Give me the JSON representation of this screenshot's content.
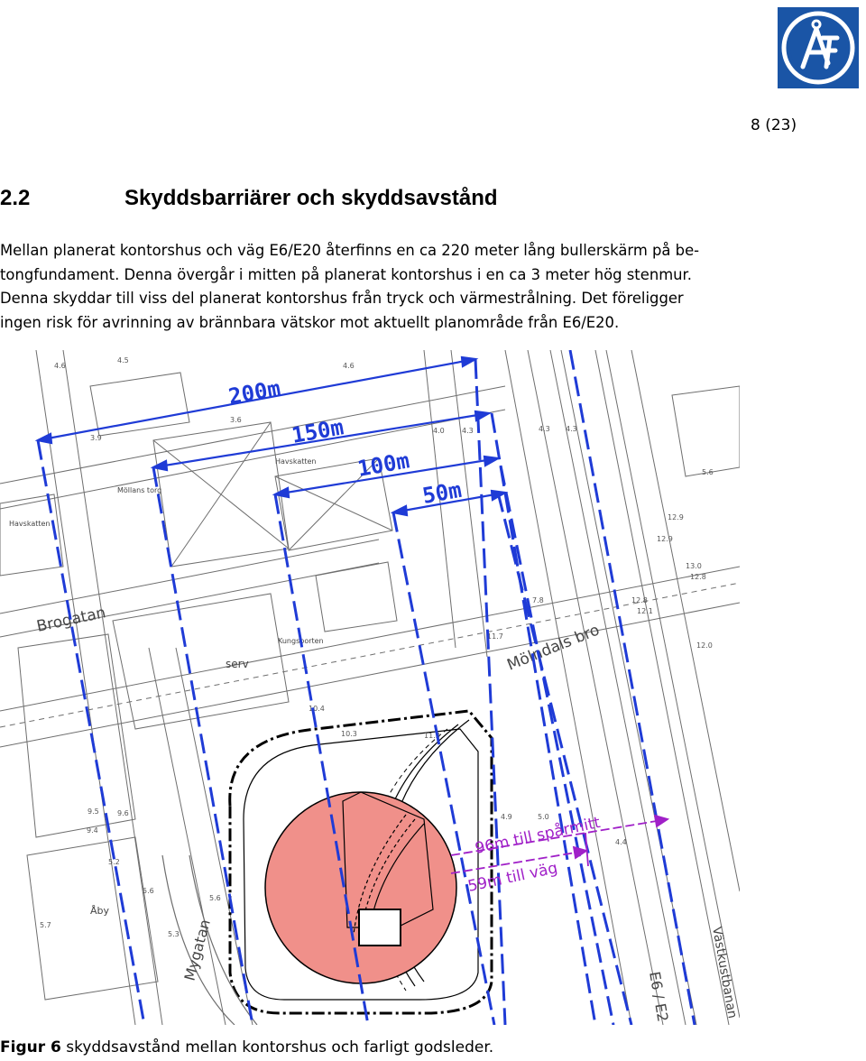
{
  "header": {
    "logo_name": "company-logo",
    "page_number": "8 (23)"
  },
  "section": {
    "number": "2.2",
    "title": "Skyddsbarriärer och skyddsavstånd"
  },
  "paragraph_lines": [
    "Mellan planerat kontorshus och väg E6/E20 återfinns en ca 220 meter lång bullerskärm på be-",
    "tongfundament. Denna övergår i mitten på planerat kontorshus i en ca 3 meter hög stenmur.",
    "Denna skyddar till viss del planerat kontorshus från tryck och värmestrålning. Det föreligger",
    "ingen risk för avrinning av brännbara vätskor mot aktuellt planområde från E6/E20."
  ],
  "map": {
    "distance_labels": [
      "200m",
      "150m",
      "100m",
      "50m"
    ],
    "annotations": [
      "96m till spårmitt",
      "59m till väg"
    ],
    "street_labels": [
      "Brogatan",
      "Mölndals bro",
      "Mygatan",
      "Västkustbanan",
      "E6 / E2",
      "Kungsporten",
      "Havskatten",
      "Havskatten",
      "Möllans torg",
      "serv",
      "Åby"
    ],
    "colors": {
      "distance_lines": "#1f3bd6",
      "annotation": "#a020c8",
      "building_circle": "#f0908a"
    }
  },
  "caption": {
    "label": "Figur 6",
    "text": " skyddsavstånd mellan kontorshus och farligt godsleder."
  }
}
